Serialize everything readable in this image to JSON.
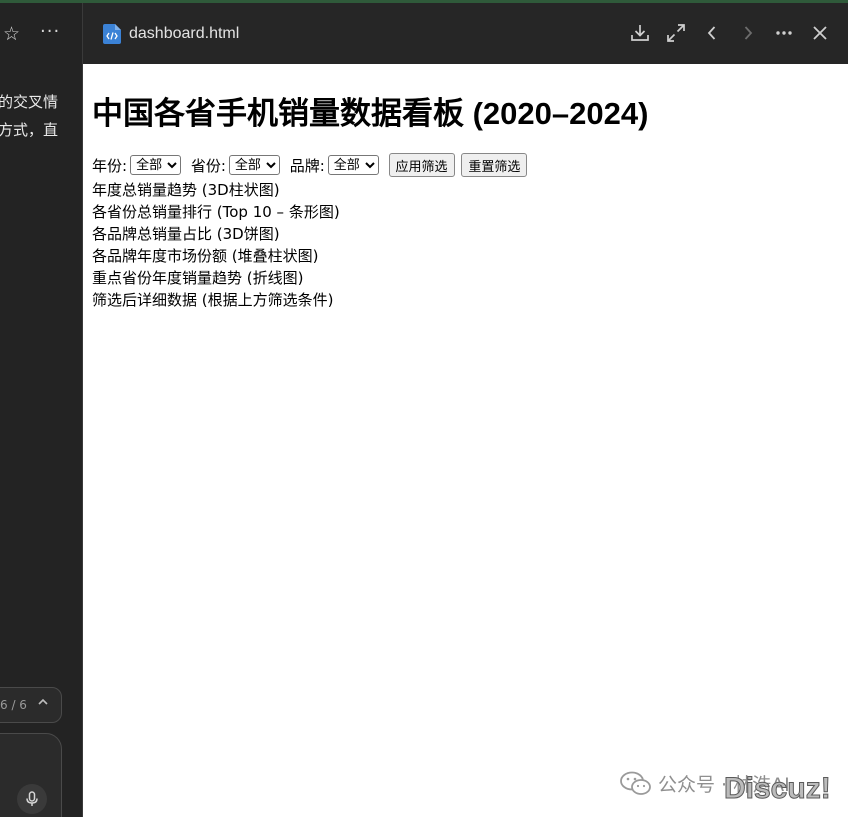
{
  "left_pane": {
    "text_line_1": "的交叉情",
    "text_line_2": "方式，直",
    "counter": "6 / 6"
  },
  "header": {
    "file_name": "dashboard.html"
  },
  "page": {
    "title": "中国各省手机销量数据看板 (2020–2024)",
    "filters": {
      "year_label": "年份:",
      "year_value": "全部",
      "province_label": "省份:",
      "province_value": "全部",
      "brand_label": "品牌:",
      "brand_value": "全部",
      "apply_button": "应用筛选",
      "reset_button": "重置筛选"
    },
    "section_titles": [
      "年度总销量趋势 (3D柱状图)",
      "各省份总销量排行 (Top 10 – 条形图)",
      "各品牌总销量占比 (3D饼图)",
      "各品牌年度市场份额 (堆叠柱状图)",
      "重点省份年度销量趋势 (折线图)",
      "筛选后详细数据 (根据上方筛选条件)"
    ]
  },
  "watermark": {
    "text": "公众号 · 林浩AI",
    "brand": "Discuz!"
  },
  "colors": {
    "left_pane_bg": "#232323",
    "header_bg": "#262626",
    "file_icon": "#3b82d6",
    "top_accent": "#2f5a3a"
  }
}
